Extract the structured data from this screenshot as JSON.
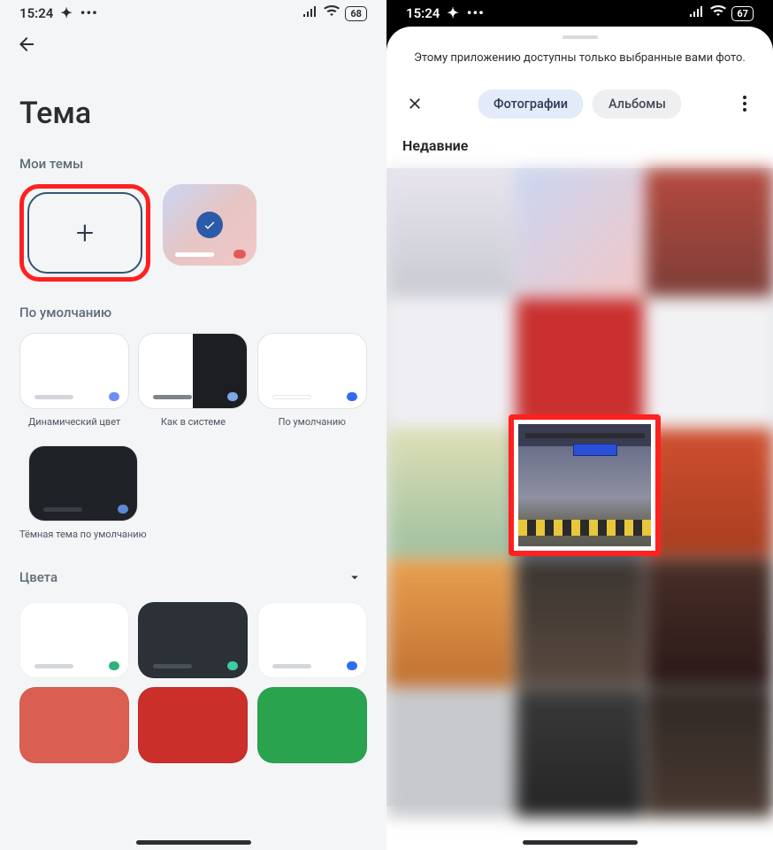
{
  "status": {
    "time": "15:24",
    "battery_left": "68",
    "battery_right": "67"
  },
  "left": {
    "title": "Тема",
    "my_themes_label": "Мои темы",
    "defaults_label": "По умолчанию",
    "defaults": {
      "dynamic": "Динамический цвет",
      "system": "Как в системе",
      "default": "По умолчанию",
      "dark_default": "Тёмная тема по умолчанию"
    },
    "colors_label": "Цвета"
  },
  "right": {
    "access_note": "Этому приложению доступны только выбранные вами фото.",
    "tab_photos": "Фотографии",
    "tab_albums": "Альбомы",
    "recents": "Недавние"
  }
}
